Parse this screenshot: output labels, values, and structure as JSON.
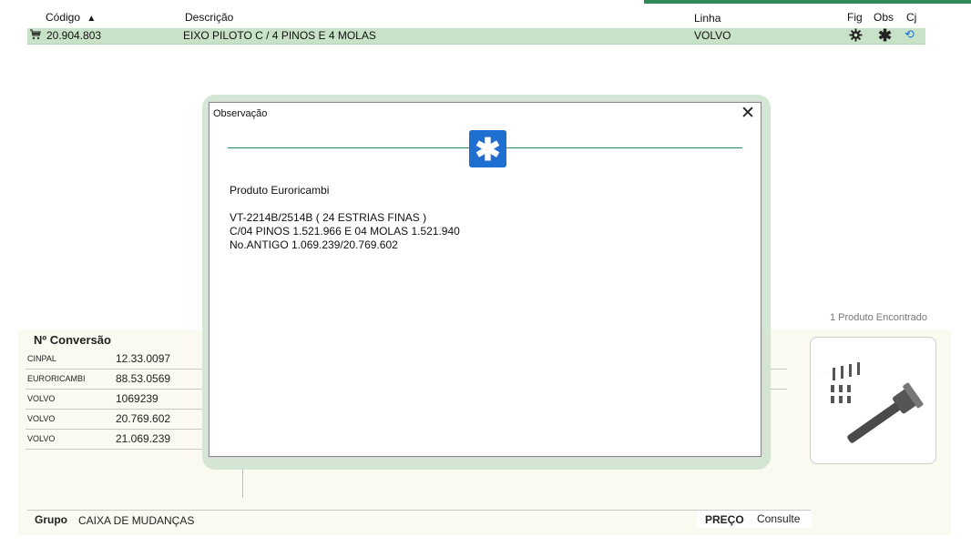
{
  "table": {
    "headers": {
      "codigo": "Código",
      "descricao": "Descrição",
      "linha": "Linha",
      "fig": "Fig",
      "obs": "Obs",
      "cj": "Cj"
    },
    "row": {
      "codigo": "20.904.803",
      "descricao": "EIXO PILOTO C / 4 PINOS E 4 MOLAS",
      "linha": "VOLVO"
    }
  },
  "conversion": {
    "title": "Nº Conversão",
    "rows": [
      {
        "brand": "CINPAL",
        "code": "12.33.0097"
      },
      {
        "brand": "EURORICAMBI",
        "code": "88.53.0569"
      },
      {
        "brand": "VOLVO",
        "code": "1069239"
      },
      {
        "brand": "VOLVO",
        "code": "20.769.602"
      },
      {
        "brand": "VOLVO",
        "code": "21.069.239"
      }
    ]
  },
  "found_text": "1 Produto Encontrado",
  "footer": {
    "grupo_label": "Grupo",
    "grupo_value": "CAIXA DE MUDANÇAS",
    "preco_label": "PREÇO",
    "preco_value": "Consulte"
  },
  "dialog": {
    "title": "Observação",
    "close": "✕",
    "line1": "Produto Euroricambi",
    "line2": "VT-2214B/2514B ( 24 ESTRIAS FINAS )",
    "line3": "C/04 PINOS 1.521.966 E 04 MOLAS 1.521.940",
    "line4": "No.ANTIGO 1.069.239/20.769.602"
  },
  "colors": {
    "accent": "#2e8b57",
    "row_bg": "#c8e2c8",
    "dialog_icon": "#1f6fd1",
    "panel_bg": "#fbfaf0"
  }
}
